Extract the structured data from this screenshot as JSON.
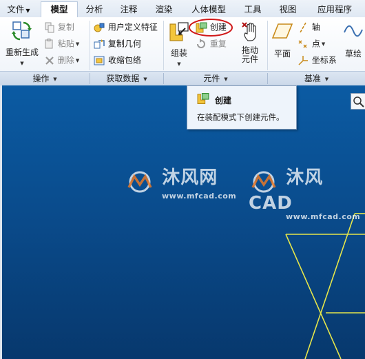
{
  "tabs": [
    {
      "label": "文件",
      "dropdown": true
    },
    {
      "label": "模型",
      "active": true
    },
    {
      "label": "分析"
    },
    {
      "label": "注释"
    },
    {
      "label": "渲染"
    },
    {
      "label": "人体模型"
    },
    {
      "label": "工具"
    },
    {
      "label": "视图"
    },
    {
      "label": "应用程序"
    }
  ],
  "ribbon": {
    "regenerate": "重新生成",
    "copy": "复制",
    "paste": "粘贴",
    "delete": "删除",
    "user_defined_feature": "用户定义特征",
    "copy_geometry": "复制几何",
    "shrinkwrap": "收缩包络",
    "assemble": "组装",
    "create": "创建",
    "repeat": "重复",
    "drag_components": "拖动\n元件",
    "drag_line1": "拖动",
    "drag_line2": "元件",
    "plane": "平面",
    "axis": "轴",
    "point": "点",
    "csys": "坐标系",
    "sketch": "草绘"
  },
  "groups": {
    "operations": "操作",
    "get_data": "获取数据",
    "component": "元件",
    "datum": "基准"
  },
  "tooltip": {
    "title": "创建",
    "description": "在装配模式下创建元件。"
  },
  "watermark": {
    "text1": "沐风网",
    "url1": "www.mfcad.com",
    "text2": "沐风CAD",
    "url2": "www.mfcad.com"
  },
  "colors": {
    "viewport_top": "#0b5ba3",
    "viewport_bottom": "#07386d",
    "highlight_circle": "#d01818",
    "wireframe": "#e6e64a"
  }
}
